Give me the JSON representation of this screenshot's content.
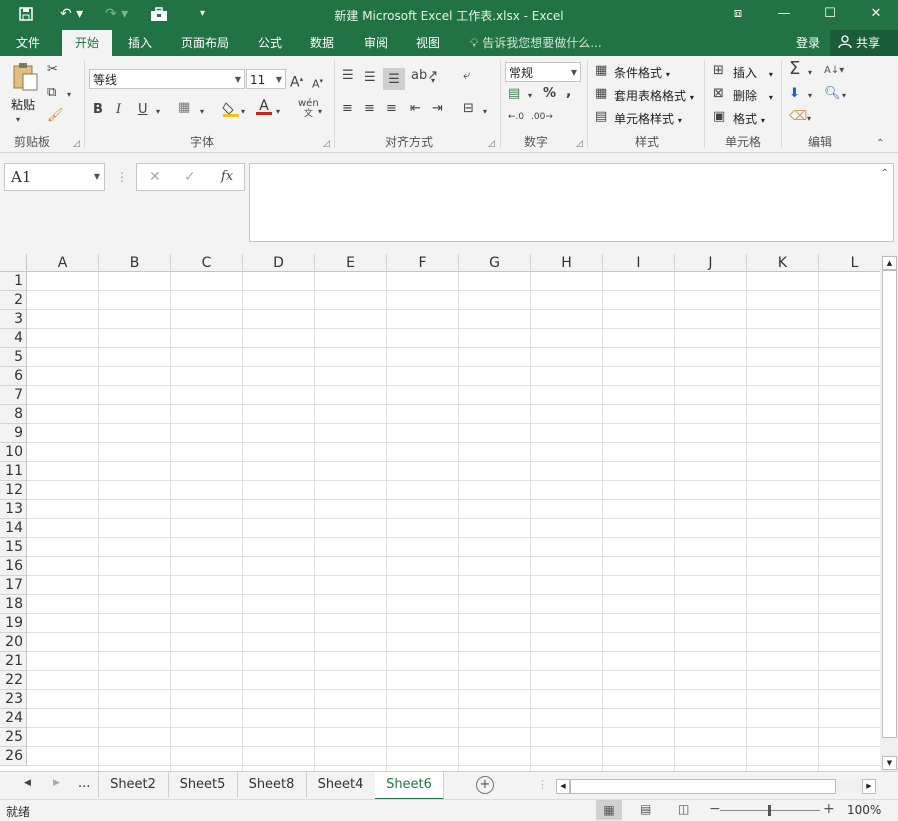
{
  "title_bar": {
    "title": "新建 Microsoft Excel 工作表.xlsx - Excel"
  },
  "ribbon_tabs": [
    "文件",
    "开始",
    "插入",
    "页面布局",
    "公式",
    "数据",
    "审阅",
    "视图"
  ],
  "active_tab": "开始",
  "tell_me": "告诉我您想要做什么...",
  "login": "登录",
  "share": "共享",
  "clipboard": {
    "paste_label": "粘贴",
    "group_label": "剪贴板"
  },
  "font": {
    "font_name": "等线",
    "font_size": "11",
    "bold": "B",
    "italic": "I",
    "underline": "U",
    "wen": "wén",
    "group_label": "字体"
  },
  "alignment": {
    "group_label": "对齐方式"
  },
  "number": {
    "format": "常规",
    "percent": "%",
    "comma": ",",
    "group_label": "数字"
  },
  "styles": {
    "conditional": "条件格式",
    "table_format": "套用表格格式",
    "cell_styles": "单元格样式",
    "group_label": "样式"
  },
  "cells": {
    "insert": "插入",
    "delete": "删除",
    "format": "格式",
    "group_label": "单元格"
  },
  "editing": {
    "group_label": "编辑"
  },
  "formula_bar": {
    "name_box": "A1",
    "fx": "fx",
    "value": ""
  },
  "columns": [
    "A",
    "B",
    "C",
    "D",
    "E",
    "F",
    "G",
    "H",
    "I",
    "J",
    "K",
    "L"
  ],
  "rows": [
    "1",
    "2",
    "3",
    "4",
    "5",
    "6",
    "7",
    "8",
    "9",
    "10",
    "11",
    "12",
    "13",
    "14",
    "15",
    "16",
    "17",
    "18",
    "19",
    "20",
    "21",
    "22",
    "23",
    "24",
    "25",
    "26"
  ],
  "sheets": [
    "Sheet2",
    "Sheet5",
    "Sheet8",
    "Sheet4",
    "Sheet6"
  ],
  "active_sheet": "Sheet6",
  "sheet_overflow": "...",
  "status": {
    "ready": "就绪",
    "zoom": "100%"
  },
  "colors": {
    "accent": "#217346",
    "share_bg": "#1a5c38"
  }
}
